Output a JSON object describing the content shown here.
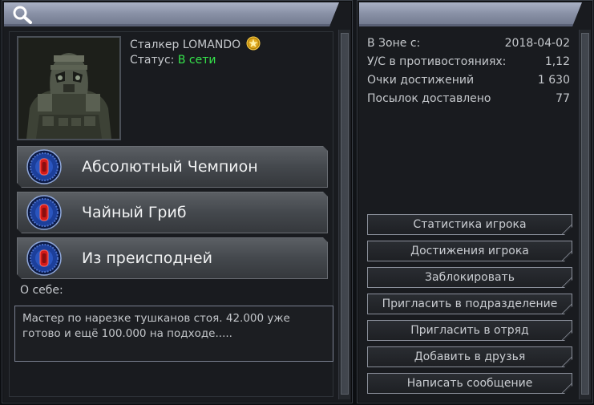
{
  "profile": {
    "name": "Сталкер LOMANDO",
    "status_label": "Статус:",
    "status_value": "В сети",
    "rank_icon": "rank-star-icon",
    "avatar_icon": "stalker-exosuit-avatar"
  },
  "achievements": [
    {
      "label": "Абсолютный Чемпион",
      "icon": "achievement-emblem-icon"
    },
    {
      "label": "Чайный Гриб",
      "icon": "achievement-emblem-icon"
    },
    {
      "label": "Из преисподней",
      "icon": "achievement-emblem-icon"
    }
  ],
  "about": {
    "label": "О себе:",
    "text": "Мастер по нарезке тушканов стоя. 42.000 уже готово и ещё 100.000 на подходе....."
  },
  "stats": [
    {
      "label": "В Зоне с:",
      "value": "2018-04-02"
    },
    {
      "label": "У/С в противостояниях:",
      "value": "1,12"
    },
    {
      "label": "Очки достижений",
      "value": "1 630"
    },
    {
      "label": "Посылок доставлено",
      "value": "77"
    }
  ],
  "actions": [
    {
      "label": "Статистика игрока"
    },
    {
      "label": "Достижения игрока"
    },
    {
      "label": "Заблокировать"
    },
    {
      "label": "Пригласить в подразделение"
    },
    {
      "label": "Пригласить в отряд"
    },
    {
      "label": "Добавить в друзья"
    },
    {
      "label": "Написать сообщение"
    }
  ],
  "colors": {
    "status_online": "#35e44b",
    "header": "#8a92a7",
    "panel_bg": "#191b1f",
    "emblem_blue": "#1c3f9b",
    "emblem_red": "#d41a1a"
  }
}
